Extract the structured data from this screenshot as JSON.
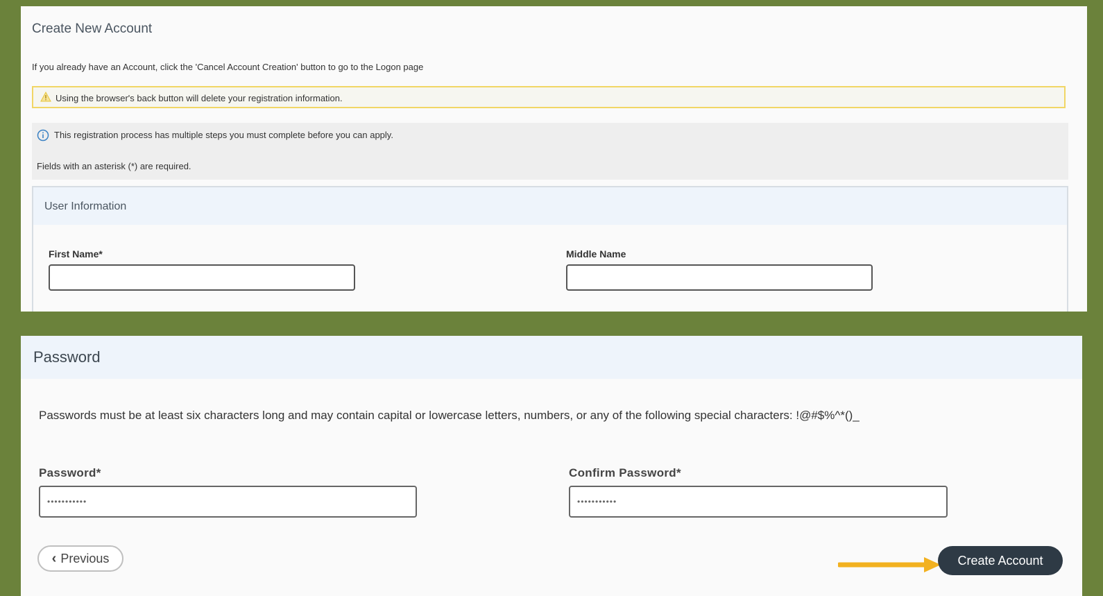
{
  "account": {
    "title": "Create New Account",
    "intro": "If you already have an Account, click the 'Cancel Account Creation' button to go to the Logon page",
    "warning": "Using the browser's back button will delete your registration information.",
    "info": "This registration process has multiple steps you must complete before you can apply.",
    "required_note": "Fields with an asterisk (*) are required."
  },
  "user_info": {
    "title": "User Information",
    "first_name_label": "First Name*",
    "first_name_value": "",
    "middle_name_label": "Middle Name",
    "middle_name_value": ""
  },
  "password_section": {
    "title": "Password",
    "rules": "Passwords must be at least six characters long and may contain capital or lowercase letters, numbers, or any of the following special characters: !@#$%^*()_",
    "password_label": "Password*",
    "password_value": "•••••••••••",
    "confirm_label": "Confirm Password*",
    "confirm_value": "•••••••••••"
  },
  "actions": {
    "previous_label": "Previous",
    "create_label": "Create Account"
  },
  "colors": {
    "background": "#6b823b",
    "warning_border": "#f1d665",
    "info_icon": "#3b82c4",
    "primary_button": "#2e3a45",
    "annotation_arrow": "#f2b120"
  },
  "icons": {
    "warning": "warning-triangle-icon",
    "info": "info-circle-icon",
    "previous": "chevron-left-icon",
    "annotation": "arrow-right-icon"
  }
}
